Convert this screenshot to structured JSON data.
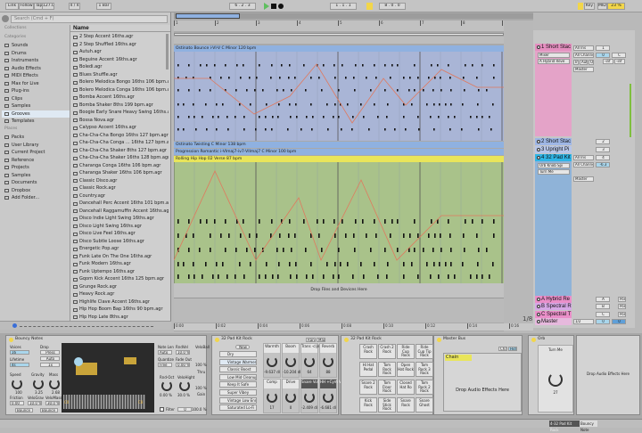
{
  "transport": {
    "link": "Link",
    "follow": "Follow",
    "tap": "Tap",
    "tempo": "127.00",
    "signature": "4 / 4",
    "quantize": "1 Bar",
    "position": "6 . 2 . 3",
    "loop_start": "1 . 1 . 1",
    "loop_length": "8 . 0 . 0",
    "key": "Key",
    "midi": "MIDI",
    "cpu": "23 %"
  },
  "browser": {
    "search_placeholder": "Search (Cmd + F)",
    "collections_label": "Collections",
    "categories_label": "Categories",
    "places_label": "Places",
    "categories": [
      "Sounds",
      "Drums",
      "Instruments",
      "Audio Effects",
      "MIDI Effects",
      "Max for Live",
      "Plug-ins",
      "Clips",
      "Samples",
      "Grooves",
      "Templates"
    ],
    "selected_category": "Grooves",
    "places": [
      "Packs",
      "User Library",
      "Current Project",
      "Reference",
      "Projects",
      "Samples",
      "Documents",
      "Dropbox",
      "Add Folder..."
    ],
    "name_header": "Name",
    "files": [
      "2 Step Accent 16ths.agr",
      "2 Step Shuffled 16ths.agr",
      "Autuh.agr",
      "Beguine Accent 16ths.agr",
      "Boledi.agr",
      "Blues Shuffle.agr",
      "Bolero Melodica Bongo 16ths 106 bpm.agr",
      "Bolero Melodica Conga 16ths 106 bpm.agr",
      "Bomba Accent 16ths.agr",
      "Bomba Shaker 8ths 199 bpm.agr",
      "Boogie Early Snare Heavy Swing 16ths.agr",
      "Bossa Nova.agr",
      "Calypso Accent 16ths.agr",
      "Cha-Cha-Cha Bongo 16ths 127 bpm.agr",
      "Cha-Cha-Cha Conga ... 16ths 127 bpm.agr",
      "Cha-Cha-Cha Shaker 8ths 127 bpm.agr",
      "Cha-Cha-Cha Shaker 16ths 128 bpm.agr",
      "Charanga Conga 16ths 106 bpm.agr",
      "Charanga Shaker 16ths 106 bpm.agr",
      "Classic Disco.agr",
      "Classic Rock.agr",
      "Country.agr",
      "Dancehall Perc Accent 16ths 101 bpm.agr",
      "Dancehall Raggamuffin Accent 16ths.agr",
      "Disco Indie Light Swing 16ths.agr",
      "Disco Light Swing 16ths.agr",
      "Disco Live Feel 16ths.agr",
      "Disco Subtle Loose 16ths.agr",
      "Energetic Pop.agr",
      "Funk Late On The One 16ths.agr",
      "Funk Modern 16ths.agr",
      "Funk Uptempo 16ths.agr",
      "Gqom Kick Accent 16ths 125 bpm.agr",
      "Grunge Rock.agr",
      "Heavy Rock.agr",
      "Highlife Clave Accent 16ths.agr",
      "Hip Hop Boom Bap 16ths 90 bpm.agr",
      "Hip Hop Late 8ths.agr"
    ]
  },
  "arrangement": {
    "bars": [
      "1",
      "2",
      "3",
      "4",
      "5",
      "6",
      "7",
      "8",
      "9"
    ],
    "time_ticks": [
      "0:00",
      "0:02",
      "0:04",
      "0:06",
      "0:08",
      "0:10",
      "0:12",
      "0:14",
      "0:16"
    ],
    "clips": [
      "Ostinato Bounce i-VI-V C Minor 120 bpm",
      "Ostinato Twisting C Minor 138 bpm",
      "Progression Romantic i-VImaj7-iv7-VIImaj7 C Minor 100 bpm",
      "Rolling Hip Hop 02 Verse 87 bpm"
    ],
    "drop_text": "Drop Files and Devices Here",
    "zoom_ratio": "1/8",
    "set_label": "Set"
  },
  "mixer": {
    "tracks": [
      {
        "name": "1 Short Stac",
        "color": "#e58fc0",
        "number": "1",
        "devices": [
          "Mixer",
          "A Hybrid Reve"
        ]
      },
      {
        "name": "2 Short Stac",
        "color": "#9fb7e6",
        "number": "2"
      },
      {
        "name": "3 Upright Pi",
        "color": "#9fb7e6",
        "number": "3"
      },
      {
        "name": "4 32 Pad Kit",
        "color": "#2fb5e6",
        "number": "4",
        "devices": [
          "Orb Knob Spi",
          "Turn Me"
        ],
        "volume": "-6.3"
      }
    ],
    "input": "All Ins",
    "channel": "All Channe",
    "monitor": [
      "In",
      "Auto",
      "Off"
    ],
    "output": "Master",
    "pan": "C",
    "inf": "-inf",
    "vol1": "0",
    "returns": [
      {
        "name": "A Hybrid Re",
        "letter": "A"
      },
      {
        "name": "B Spectral R",
        "letter": "B"
      },
      {
        "name": "C Spectral T",
        "letter": "C"
      }
    ],
    "master": {
      "name": "Master",
      "output": "1/2",
      "vol": "0",
      "pan": "0"
    },
    "post": "Post"
  },
  "devices": {
    "bouncy": {
      "title": "Bouncy Notes",
      "voices": "Voices",
      "voices_val": "16",
      "drop": "Drop",
      "press": "Press",
      "auto": "Auto",
      "x1": "1x",
      "lifetime": "Lifetime",
      "lifetime_val": "4s",
      "speed": "Speed",
      "speed_val": "100",
      "gravity": "Gravity",
      "gravity_val": "3.25",
      "mass": "Mass",
      "mass_val": "2.68",
      "friction": "Friction",
      "friction_val": "0.00",
      "velograv": "VeloGrav",
      "velograv_val": "10.0 %",
      "velomass": "VeloMass",
      "velomass_val": "30.0 %",
      "bounce1": "Bounce",
      "bounce2": "Bounce",
      "range_lo": "C0",
      "range_hi": "C8",
      "notelen": "Note Len",
      "notelen_val": "Auto",
      "rndvel": "RndVel",
      "rndvel_val": "10.0 %",
      "quantize": "Quantize",
      "quantize_val": "Free",
      "fadeout": "Fade Out",
      "fadeout_val": "0.00 %",
      "rndoct": "Rnd-Oct",
      "rndoct_val": "0.00 %",
      "velohight": "VeloHight",
      "velohight_val": "30.0 %",
      "filter": "Filter",
      "filter_val": "0",
      "veloball": "VeloBall",
      "veloball_val": "100 %",
      "thru": "Thru",
      "thru_val": "100 %",
      "gain": "Gain",
      "gain_val": "100.0 %"
    },
    "rack": {
      "title": "32 Pad Kit Rock",
      "rand": "Rand",
      "map": "Map",
      "new": "New",
      "chains": [
        "Dry",
        "Vintage Warmer",
        "Classic Boost",
        "Low Mid Cleanup",
        "Keep It Safe",
        "Super Vibey",
        "Vintage Low End",
        "Saturated Lo-Fi"
      ],
      "macros": [
        {
          "name": "Warmth",
          "val": "-9.637 dl"
        },
        {
          "name": "Boom",
          "val": "-10.204 dl"
        },
        {
          "name": "Trans -cljn-",
          "val": "64"
        },
        {
          "name": "Reverb",
          "val": "88"
        },
        {
          "name": "Comp",
          "val": "17"
        },
        {
          "name": "Drive",
          "val": "0"
        },
        {
          "name": "Snare Vol",
          "val": "-2.409 dl"
        },
        {
          "name": "HH +Cym Vol",
          "val": "-6.681 dl"
        }
      ]
    },
    "drumrack": {
      "title": "32 Pad Kit Rock",
      "pads": [
        "Kick Rock",
        "Side Stick Rock",
        "Snare Rock",
        "Snare Ghost",
        "Snare 2 Rock",
        "Tom Floor Rock",
        "Closed Hat Ro",
        "Tom Rock 2 Rock",
        "Hi Hat Pedal",
        "Tom Rock Rock",
        "Open Hat Rock",
        "Tom Rock 3 Rock",
        "Crash Rock",
        "Crash 2 Rock",
        "Ride Cup Rock",
        "Ride Cup Tip Rock"
      ],
      "m": "M",
      "s": "S"
    },
    "masterbus": {
      "title": "Master Bus",
      "chain": "Chain",
      "drop": "Drop Audio Effects Here",
      "chain_btn": "Chain",
      "hide": "Hide"
    },
    "orb": {
      "title": "Orb",
      "knob_label": "Turn Me",
      "knob_val": "27"
    },
    "drop_right": "Drop Audio Effects Here"
  },
  "status": {
    "track": "4-32 Pad Kit Rock",
    "device": "Bouncy Note"
  },
  "colors": {
    "blue_clip": "#8fb1e0",
    "green_clip": "#a9c28a",
    "yellow_hdr": "#e9e55a",
    "pink": "#e58fc0",
    "accent": "#f2d64a"
  }
}
